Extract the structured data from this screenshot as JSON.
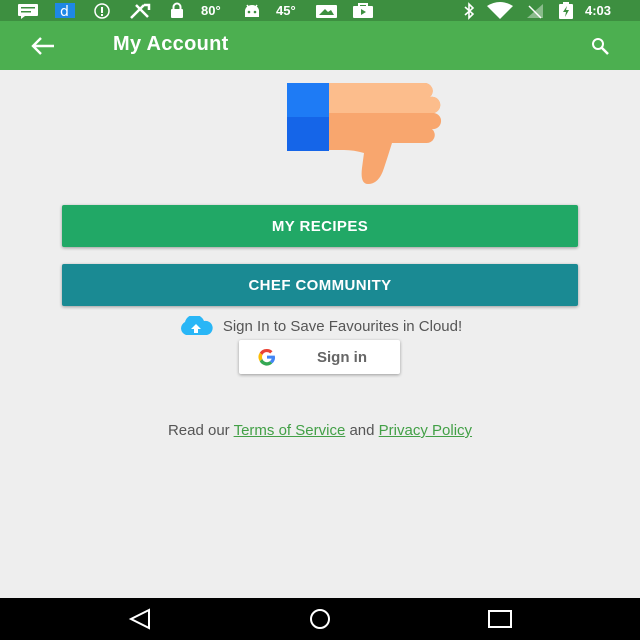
{
  "status_bar": {
    "temp1": "80°",
    "temp2": "45°",
    "time": "4:03",
    "icons": [
      "message-icon",
      "d-app-icon",
      "info-icon",
      "tool-icon",
      "lock-icon",
      "android-icon",
      "photo-icon",
      "shop-icon",
      "bluetooth-icon",
      "wifi-icon",
      "no-signal-icon",
      "battery-charging-icon"
    ]
  },
  "app_bar": {
    "title": "My Account",
    "color": "#4caf50"
  },
  "buttons": {
    "my_recipes": "MY RECIPES",
    "chef_community": "CHEF COMMUNITY",
    "recipes_color": "#21a866",
    "community_color": "#1a8a93"
  },
  "cloud_prompt": "Sign In to Save Favourites in Cloud!",
  "google_sign_in": "Sign in",
  "legal": {
    "prefix": "Read our",
    "terms": "Terms of Service",
    "and": "and",
    "privacy": "Privacy Policy"
  }
}
